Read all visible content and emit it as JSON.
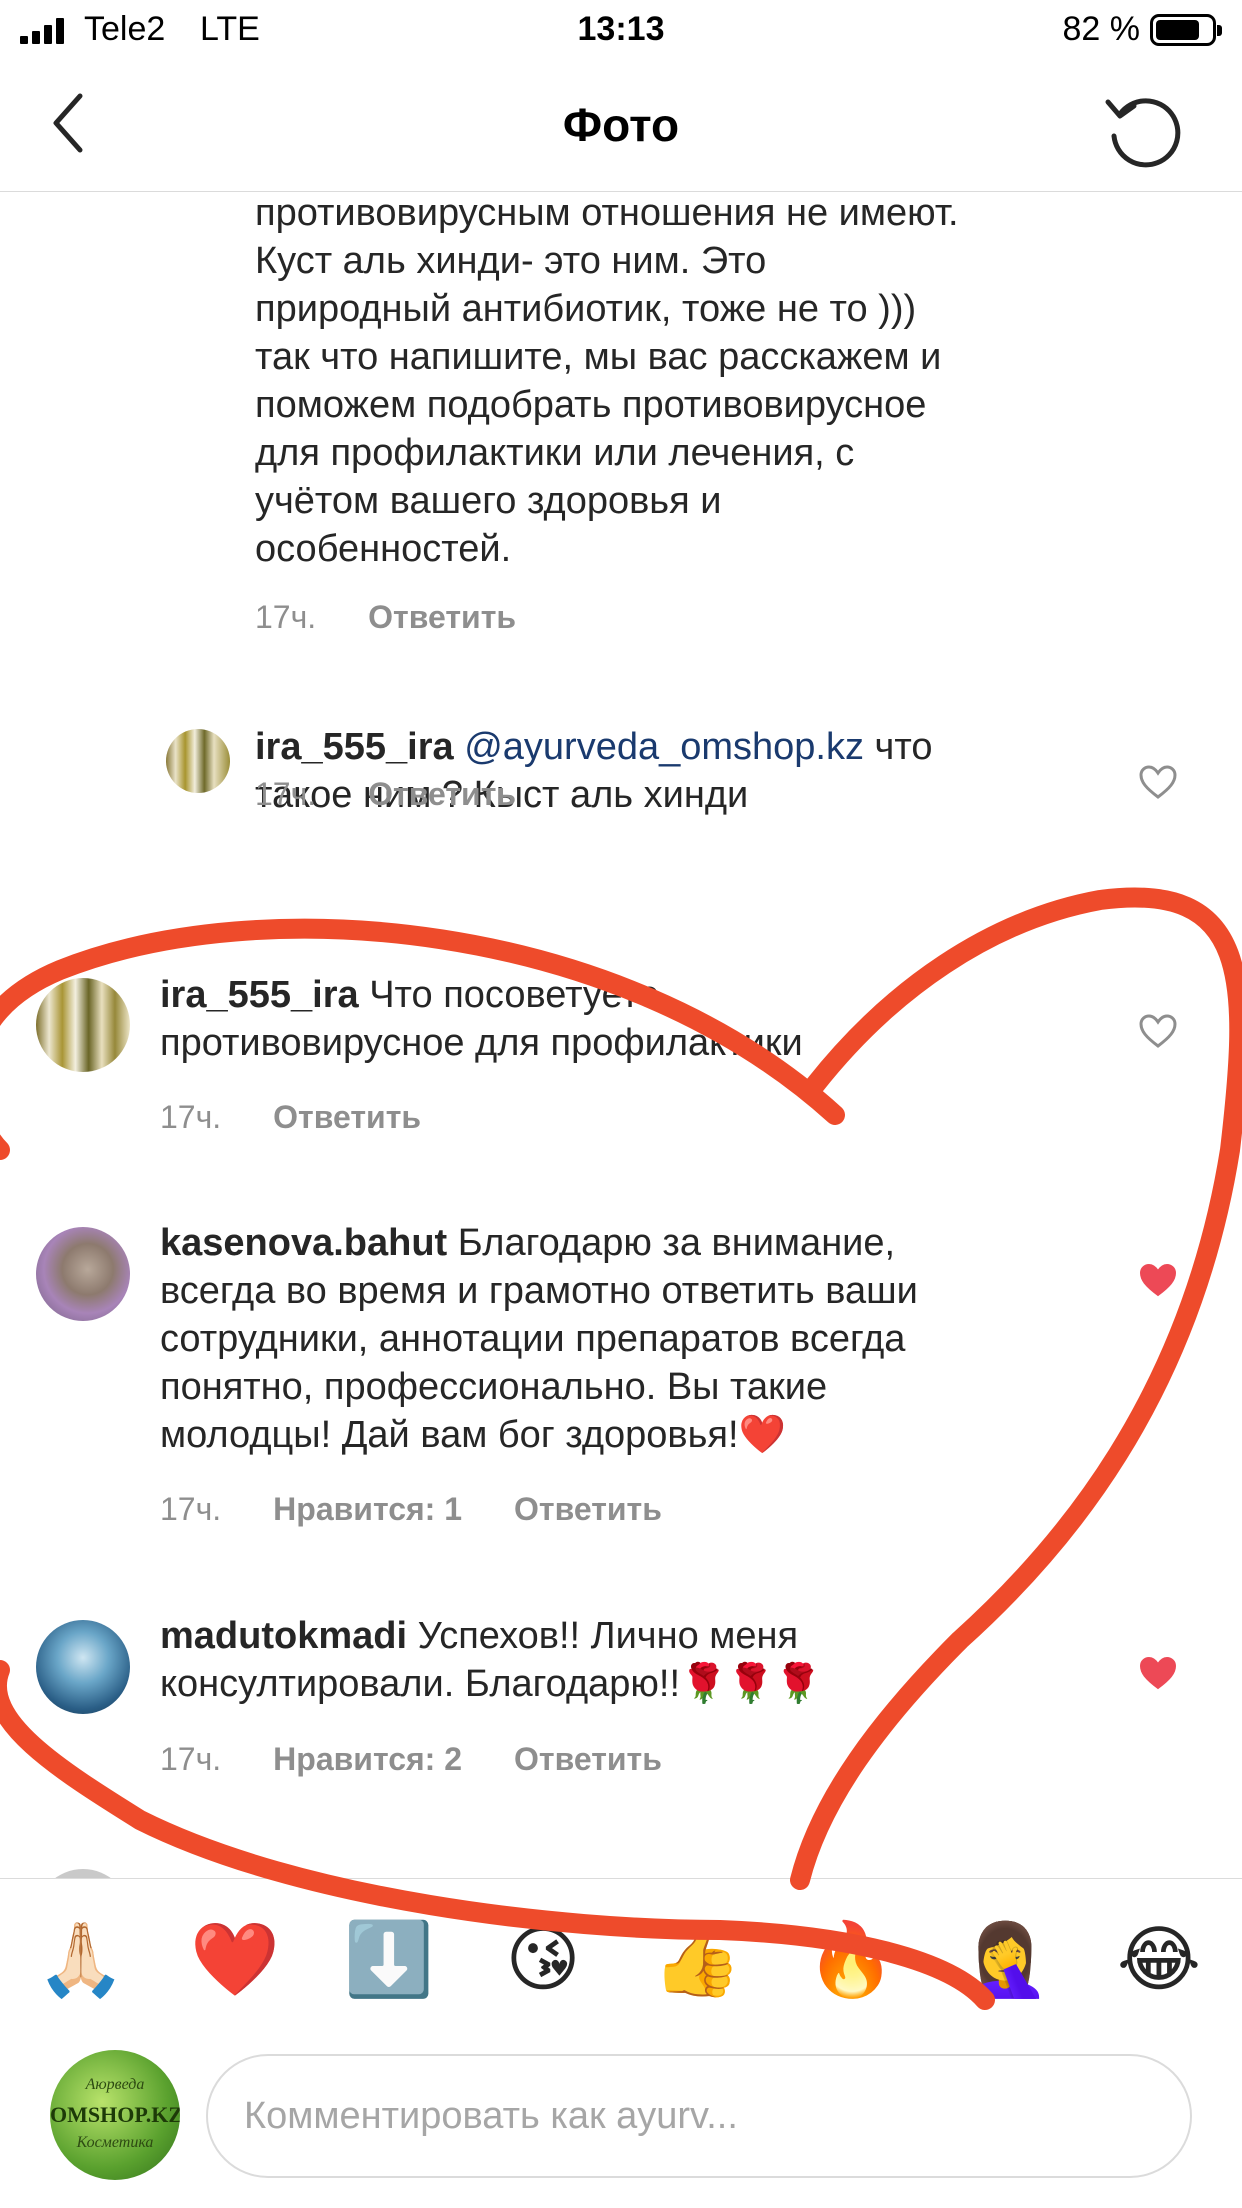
{
  "status_bar": {
    "carrier": "Tele2",
    "network": "LTE",
    "time": "13:13",
    "battery": "82 %"
  },
  "nav": {
    "title": "Фото",
    "back_icon": "chevron-left-icon",
    "refresh_icon": "refresh-icon"
  },
  "comments": {
    "top_reply": {
      "lines": [
        "противовирусным отношения не имеют.",
        "Куст аль хинди- это ним. Это",
        "природный антибиотик, тоже не то )))",
        "так что напишите, мы вас расскажем и",
        "поможем подобрать противовирусное",
        "для профилактики или лечения, с",
        "учётом вашего здоровья и",
        "особенностей."
      ],
      "time": "17ч.",
      "reply": "Ответить"
    },
    "reply_ira": {
      "user": "ira_555_ira",
      "mention": "@ayurveda_omshop.kz",
      "text1": " что",
      "text2": "такое ним ? Кыст аль хинди",
      "time": "17ч.",
      "reply": "Ответить"
    },
    "ira_main": {
      "user": "ira_555_ira",
      "text1": " Что посоветуете",
      "text2": "противовирусное для профилактики",
      "time": "17ч.",
      "reply": "Ответить"
    },
    "kasenova": {
      "user": "kasenova.bahut",
      "text1": " Благодарю за внимание,",
      "text2": "всегда во время и грамотно  ответить ваши",
      "text3": "сотрудники,  аннотации препаратов всегда",
      "text4": "понятно, профессионально. Вы такие",
      "text5": "молодцы! Дай вам бог здоровья!❤️",
      "time": "17ч.",
      "likes": "Нравится: 1",
      "reply": "Ответить"
    },
    "madutokmadi": {
      "user": "madutokmadi",
      "text1": " Успехов!! Лично меня",
      "text2": "консултировали. Благодарю!!🌹🌹🌹",
      "time": "17ч.",
      "likes": "Нравится: 2",
      "reply": "Ответить"
    }
  },
  "emoji_bar": [
    "🙏🏻",
    "❤️",
    "⬇️",
    "😘",
    "👍",
    "🔥",
    "🤦‍♀️",
    "😂"
  ],
  "composer": {
    "placeholder": "Комментировать как ayurv...",
    "avatar_top": "Аюрведа",
    "avatar_mid": "OMSHOP.KZ",
    "avatar_bottom": "Косметика"
  },
  "colors": {
    "liked_heart": "#ed4956",
    "drawn_heart": "#ee4b2b",
    "mention": "#1a3a6e",
    "meta": "#8e8e8e"
  }
}
